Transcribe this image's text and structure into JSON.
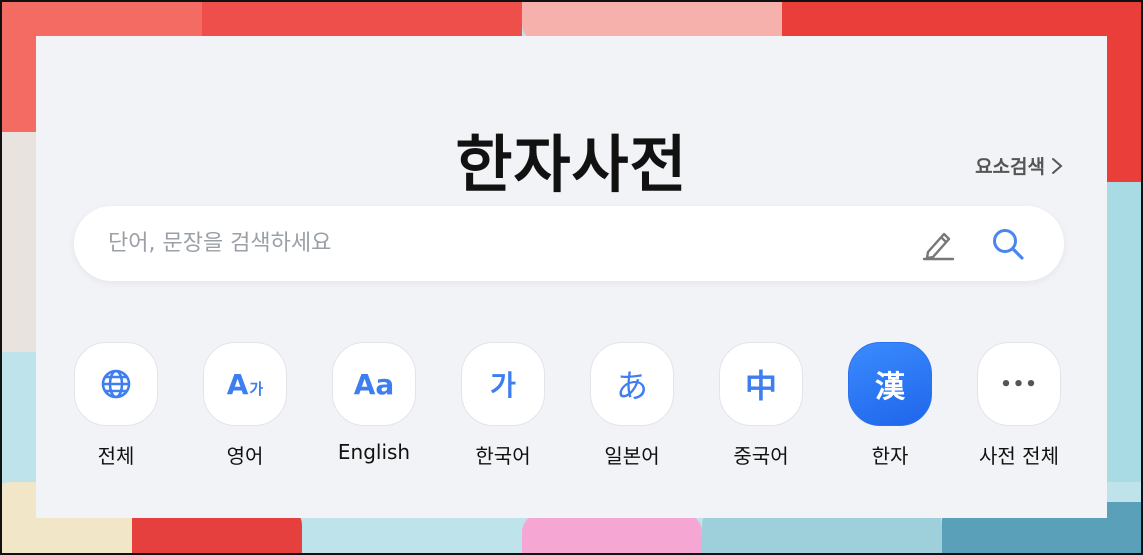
{
  "title": "한자사전",
  "element_search": {
    "label": "요소검색"
  },
  "search": {
    "placeholder": "단어, 문장을 검색하세요"
  },
  "categories": [
    {
      "label": "전체",
      "icon": "globe-icon",
      "glyph": ""
    },
    {
      "label": "영어",
      "icon": "translate-icon",
      "glyph": "A",
      "glyph_sub": "가"
    },
    {
      "label": "English",
      "icon": "english-dictionary-icon",
      "glyph": "Aa"
    },
    {
      "label": "한국어",
      "icon": "korean-icon",
      "glyph": "가"
    },
    {
      "label": "일본어",
      "icon": "japanese-icon",
      "glyph": "あ"
    },
    {
      "label": "중국어",
      "icon": "chinese-icon",
      "glyph": "中"
    },
    {
      "label": "한자",
      "icon": "hanja-icon",
      "glyph": "漢",
      "active": true
    },
    {
      "label": "사전 전체",
      "icon": "more-icon",
      "glyph": "•••"
    }
  ],
  "colors": {
    "accent": "#3f7ef0",
    "active_tile": "#2c72f0",
    "panel_bg": "#f2f3f7"
  }
}
